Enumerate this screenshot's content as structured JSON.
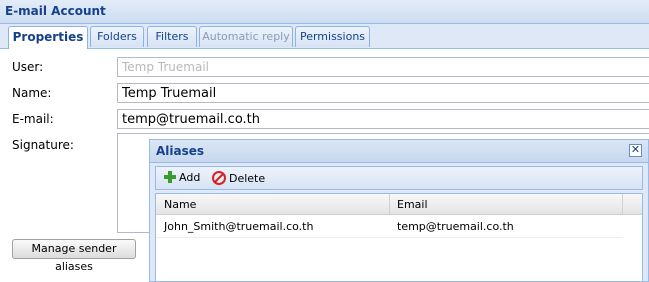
{
  "window": {
    "title": "E-mail Account"
  },
  "tabs": [
    {
      "label": "Properties"
    },
    {
      "label": "Folders"
    },
    {
      "label": "Filters"
    },
    {
      "label": "Automatic reply"
    },
    {
      "label": "Permissions"
    }
  ],
  "form": {
    "user_label": "User:",
    "user_value": "Temp Truemail",
    "name_label": "Name:",
    "name_value": "Temp Truemail",
    "email_label": "E-mail:",
    "email_value": "temp@truemail.co.th",
    "signature_label": "Signature:",
    "signature_value": "",
    "manage_button": "Manage sender aliases"
  },
  "aliases_dialog": {
    "title": "Aliases",
    "close_glyph": "✕",
    "toolbar": {
      "add_label": "Add",
      "delete_label": "Delete"
    },
    "columns": [
      "Name",
      "Email"
    ],
    "rows": [
      {
        "name": "John_Smith@truemail.co.th",
        "email": "temp@truemail.co.th"
      }
    ]
  },
  "icons": {
    "add": "plus-icon",
    "delete": "delete-icon",
    "close": "close-icon"
  },
  "colors": {
    "header_text": "#15428b",
    "border": "#99bbe8",
    "panel_bg": "#dfe8f6"
  }
}
